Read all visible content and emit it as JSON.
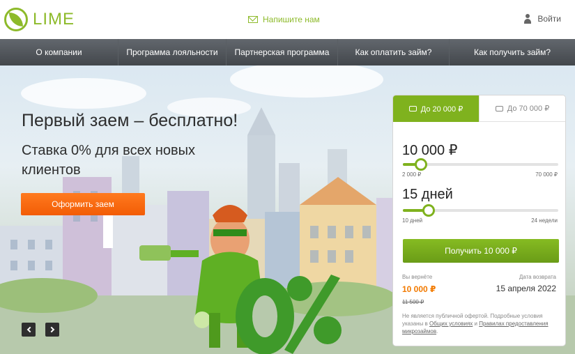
{
  "header": {
    "logo_text": "LIME",
    "write_us": "Напишите нам",
    "login": "Войти"
  },
  "nav": {
    "items": [
      {
        "label": "О компании"
      },
      {
        "label": "Программа лояльности"
      },
      {
        "label": "Партнерская программа"
      },
      {
        "label": "Как оплатить займ?"
      },
      {
        "label": "Как получить займ?"
      }
    ]
  },
  "hero": {
    "title": "Первый заем – бесплатно!",
    "subtitle": "Ставка 0% для всех новых клиентов",
    "cta": "Оформить заем"
  },
  "calculator": {
    "tabs": [
      {
        "label": "До 20 000 ₽"
      },
      {
        "label": "До 70 000 ₽"
      }
    ],
    "amount": "10 000 ₽",
    "amount_min": "2 000 ₽",
    "amount_max": "70 000 ₽",
    "amount_fraction": 0.118,
    "term": "15 дней",
    "term_min": "10 дней",
    "term_max": "24 недели",
    "term_fraction": 0.168,
    "submit": "Получить 10 000 ₽",
    "return_label": "Вы вернёте",
    "return_value": "10 000 ₽",
    "old_value": "11 500 ₽",
    "date_label": "Дата возврата",
    "date_value": "15 апреля 2022",
    "note_prefix": "Не является публичной офертой. Подробные условия указаны в",
    "note_link1": "Общих условиях",
    "note_and": "и",
    "note_link2": "Правилах предоставления микрозаймов",
    "note_suffix": "."
  },
  "colors": {
    "brand_green": "#7fb21e",
    "cta_orange": "#f25c05",
    "nav_bg": "#4f5358"
  }
}
